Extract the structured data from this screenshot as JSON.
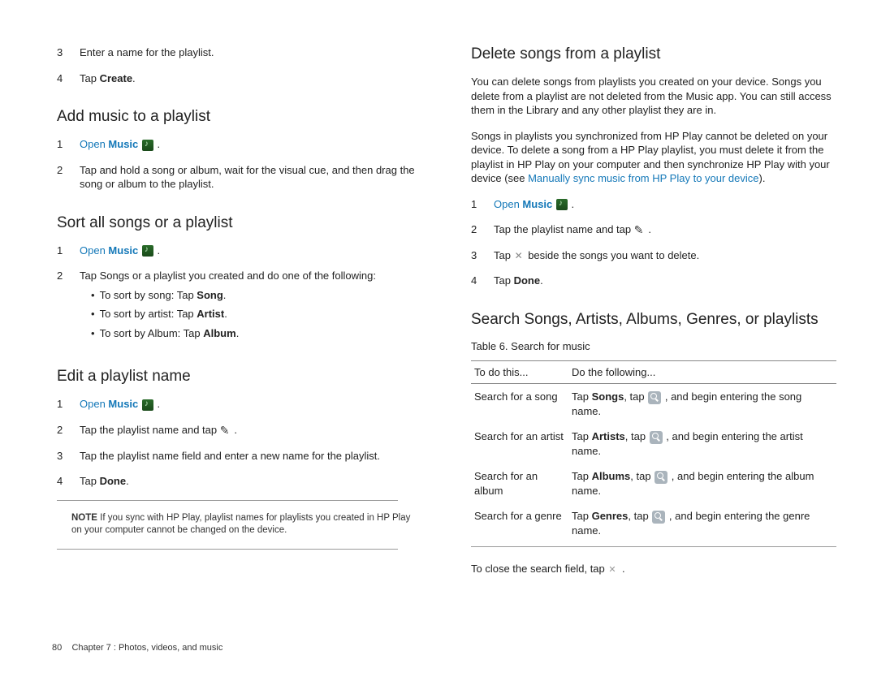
{
  "left": {
    "intro_steps": [
      {
        "n": "3",
        "text": "Enter a name for the playlist."
      },
      {
        "n": "4",
        "pre": "Tap ",
        "bold": "Create",
        "post": "."
      }
    ],
    "add_music": {
      "heading": "Add music to a playlist",
      "step1": {
        "n": "1",
        "open": "Open ",
        "music": "Music",
        "post": " ."
      },
      "step2": {
        "n": "2",
        "text": "Tap and hold a song or album, wait for the visual cue, and then drag the song or album to the playlist."
      }
    },
    "sort": {
      "heading": "Sort all songs or a playlist",
      "step1": {
        "n": "1",
        "open": "Open ",
        "music": "Music",
        "post": " ."
      },
      "step2": {
        "n": "2",
        "text": "Tap Songs or a playlist you created and do one of the following:"
      },
      "bullets": [
        {
          "pre": "To sort by song: Tap ",
          "bold": "Song",
          "post": "."
        },
        {
          "pre": "To sort by artist: Tap ",
          "bold": "Artist",
          "post": "."
        },
        {
          "pre": "To sort by Album: Tap ",
          "bold": "Album",
          "post": "."
        }
      ]
    },
    "edit": {
      "heading": "Edit a playlist name",
      "step1": {
        "n": "1",
        "open": "Open ",
        "music": "Music",
        "post": " ."
      },
      "step2": {
        "n": "2",
        "pre": "Tap the playlist name and tap ",
        "post": " ."
      },
      "step3": {
        "n": "3",
        "text": "Tap the playlist name field and enter a new name for the playlist."
      },
      "step4": {
        "n": "4",
        "pre": "Tap ",
        "bold": "Done",
        "post": "."
      }
    },
    "note": {
      "label": "NOTE",
      "text": "  If you sync with HP Play, playlist names for playlists you created in HP Play on your computer cannot be changed on the device."
    }
  },
  "right": {
    "delete": {
      "heading": "Delete songs from a playlist",
      "p1": "You can delete songs from playlists you created on your device. Songs you delete from a playlist are not deleted from the Music app. You can still access them in the Library and any other playlist they are in.",
      "p2a": "Songs in playlists you synchronized from HP Play cannot be deleted on your device. To delete a song from a HP Play playlist, you must delete it from the playlist in HP Play on your computer and then synchronize HP Play with your device (see ",
      "p2link": "Manually sync music from HP Play to your device",
      "p2b": ").",
      "step1": {
        "n": "1",
        "open": "Open ",
        "music": "Music",
        "post": " ."
      },
      "step2": {
        "n": "2",
        "pre": "Tap the playlist name and tap ",
        "post": " ."
      },
      "step3": {
        "n": "3",
        "pre": "Tap ",
        "post": " beside the songs you want to delete."
      },
      "step4": {
        "n": "4",
        "pre": "Tap ",
        "bold": "Done",
        "post": "."
      }
    },
    "search": {
      "heading": "Search Songs, Artists, Albums, Genres, or playlists",
      "caption": "Table 6.  Search for music",
      "thead": {
        "l": "To do this...",
        "r": "Do the following..."
      },
      "rows": [
        {
          "l": "Search for a song",
          "rpre": "Tap ",
          "rbold": "Songs",
          "rmid": ", tap ",
          "rpost": " , and begin entering the song name."
        },
        {
          "l": "Search for an artist",
          "rpre": "Tap ",
          "rbold": "Artists",
          "rmid": ", tap ",
          "rpost": " , and begin entering the artist name."
        },
        {
          "l": "Search for an album",
          "rpre": "Tap ",
          "rbold": "Albums",
          "rmid": ", tap ",
          "rpost": " , and begin entering the album name."
        },
        {
          "l": "Search for a genre",
          "rpre": "Tap ",
          "rbold": "Genres",
          "rmid": ", tap ",
          "rpost": " , and begin entering the genre name."
        }
      ],
      "close": {
        "pre": "To close the search field, tap ",
        "post": " ."
      }
    }
  },
  "footer": {
    "page": "80",
    "chapter": "Chapter 7 :  Photos, videos, and music"
  }
}
